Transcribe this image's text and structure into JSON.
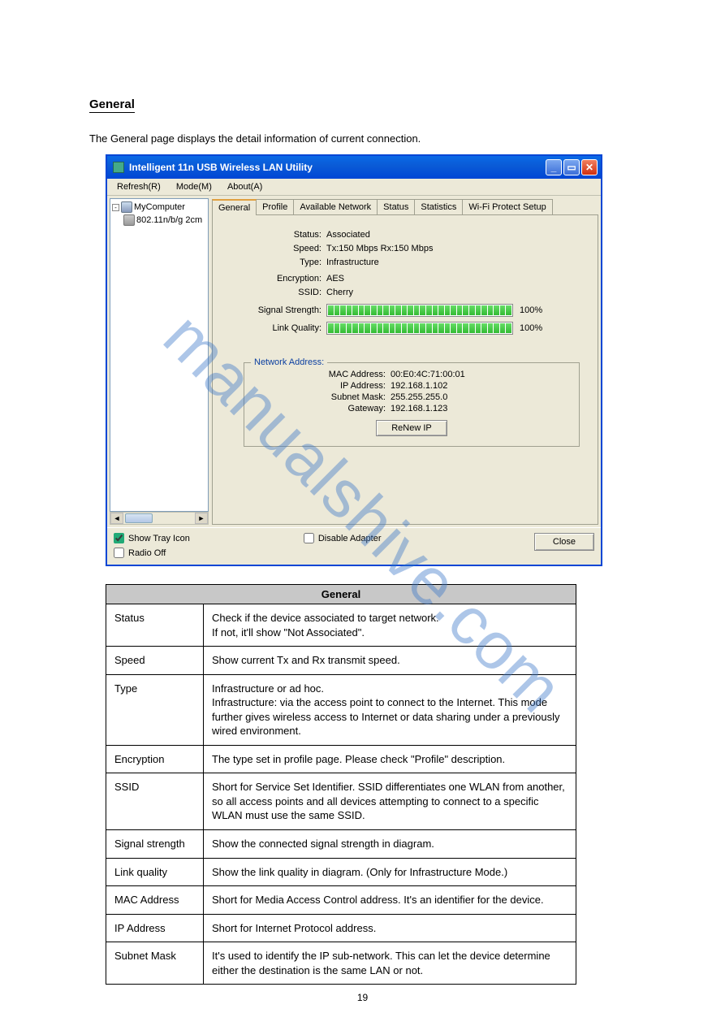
{
  "watermark": "manualshive.com",
  "section_heading": "General",
  "section_intro": "The General page displays the detail information of current connection.",
  "window": {
    "title": "Intelligent 11n USB Wireless LAN Utility",
    "menu": [
      "Refresh(R)",
      "Mode(M)",
      "About(A)"
    ],
    "win_buttons": {
      "minimize": "_",
      "maximize": "▭",
      "close": "✕"
    },
    "tree": {
      "root": "MyComputer",
      "child": "802.11n/b/g 2cm"
    },
    "tabs": [
      "General",
      "Profile",
      "Available Network",
      "Status",
      "Statistics",
      "Wi-Fi Protect Setup"
    ],
    "active_tab": 0,
    "status": {
      "Status": "Associated",
      "Speed": "Tx:150 Mbps Rx:150 Mbps",
      "Type": "Infrastructure",
      "Encryption": "AES",
      "SSID": "Cherry"
    },
    "signal_strength_pct": "100%",
    "link_quality_pct": "100%",
    "labels": {
      "signal_strength": "Signal Strength:",
      "link_quality": "Link Quality:",
      "network_address": "Network Address:",
      "status": "Status:",
      "speed": "Speed:",
      "type": "Type:",
      "encryption": "Encryption:",
      "ssid": "SSID:",
      "mac": "MAC Address:",
      "ip": "IP Address:",
      "subnet": "Subnet Mask:",
      "gateway": "Gateway:"
    },
    "network_address": {
      "mac": "00:E0:4C:71:00:01",
      "ip": "192.168.1.102",
      "subnet": "255.255.255.0",
      "gateway": "192.168.1.123"
    },
    "renew_btn": "ReNew IP",
    "show_tray_label": "Show Tray Icon",
    "show_tray_checked": true,
    "radio_off_label": "Radio Off",
    "radio_off_checked": false,
    "disable_adapter_label": "Disable Adapter",
    "disable_adapter_checked": false,
    "close_btn": "Close"
  },
  "doc_table": {
    "header": "General",
    "rows": [
      {
        "k": "Status",
        "v": "Check if the device associated to target network.\nIf not, it'll show \"Not Associated\"."
      },
      {
        "k": "Speed",
        "v": "Show current Tx and Rx transmit speed."
      },
      {
        "k": "Type",
        "v": "Infrastructure or ad hoc.\nInfrastructure: via the access point to connect to the Internet. This mode further gives wireless access to Internet or data sharing under a previously wired environment."
      },
      {
        "k": "Encryption",
        "v": "The type set in profile page. Please check \"Profile\" description."
      },
      {
        "k": "SSID",
        "v": "Short for Service Set Identifier. SSID differentiates one WLAN from another, so all access points and all devices attempting to connect to a specific WLAN must use the same SSID."
      },
      {
        "k": "Signal strength",
        "v": "Show the connected signal strength in diagram."
      },
      {
        "k": "Link quality",
        "v": "Show the link quality in diagram. (Only for Infrastructure Mode.)"
      },
      {
        "k": "MAC Address",
        "v": "Short for Media Access Control address. It's an identifier for the device."
      },
      {
        "k": "IP Address",
        "v": "Short for Internet Protocol address."
      },
      {
        "k": "Subnet Mask",
        "v": "It's used to identify the IP sub-network. This can let the device determine either the destination is the same LAN or not."
      }
    ]
  },
  "page_number": "19"
}
